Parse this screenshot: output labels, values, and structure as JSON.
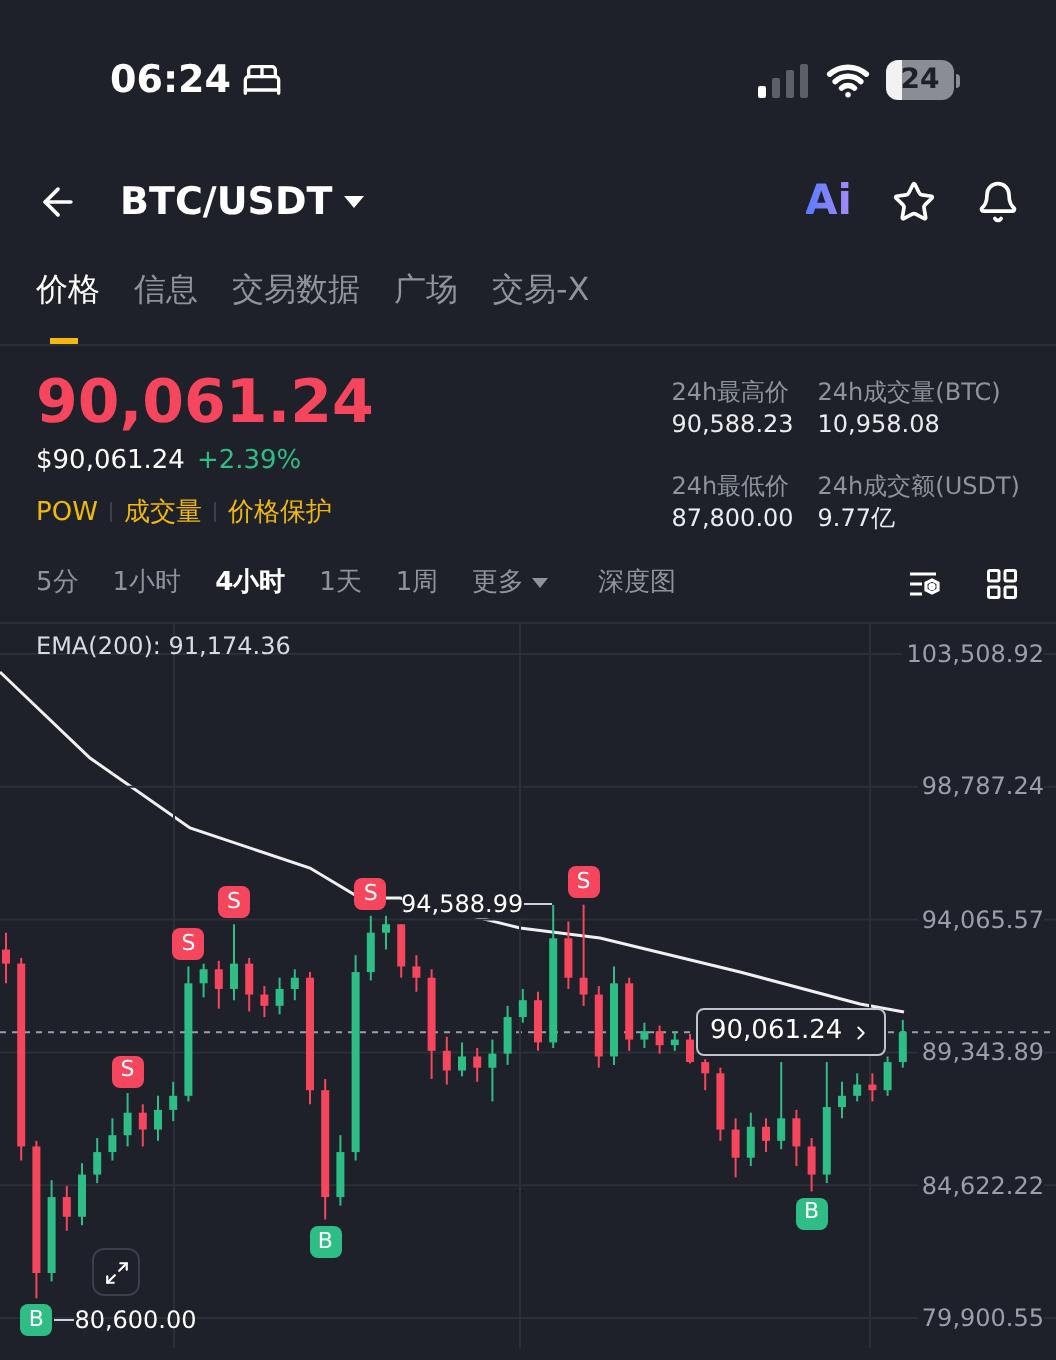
{
  "status_bar": {
    "time": "06:24",
    "battery": "24"
  },
  "header": {
    "pair": "BTC/USDT",
    "ai_label": "Ai"
  },
  "tabs": [
    {
      "label": "价格",
      "selected": true
    },
    {
      "label": "信息",
      "selected": false
    },
    {
      "label": "交易数据",
      "selected": false
    },
    {
      "label": "广场",
      "selected": false
    },
    {
      "label": "交易-X",
      "selected": false
    }
  ],
  "price": {
    "last": "90,061.24",
    "fiat": "$90,061.24",
    "change": "+2.39%",
    "tags": [
      "POW",
      "成交量",
      "价格保护"
    ]
  },
  "stats": [
    {
      "label": "24h最高价",
      "value": "90,588.23"
    },
    {
      "label": "24h成交量(BTC)",
      "value": "10,958.08"
    },
    {
      "label": "24h最低价",
      "value": "87,800.00"
    },
    {
      "label": "24h成交额(USDT)",
      "value": "9.77亿"
    }
  ],
  "intervals": [
    {
      "label": "5分",
      "selected": false,
      "kind": "plain"
    },
    {
      "label": "1小时",
      "selected": false,
      "kind": "plain"
    },
    {
      "label": "4小时",
      "selected": true,
      "kind": "plain"
    },
    {
      "label": "1天",
      "selected": false,
      "kind": "plain"
    },
    {
      "label": "1周",
      "selected": false,
      "kind": "plain"
    },
    {
      "label": "更多",
      "selected": false,
      "kind": "dropdown"
    },
    {
      "label": "深度图",
      "selected": false,
      "kind": "plain"
    }
  ],
  "chart": {
    "indicator": "EMA(200): 91,174.36",
    "price_tag": "90,061.24",
    "high_label": "94,588.99",
    "low_label": "80,600.00",
    "markers": [
      {
        "kind": "sell",
        "label": "S"
      },
      {
        "kind": "sell",
        "label": "S"
      },
      {
        "kind": "sell",
        "label": "S"
      },
      {
        "kind": "sell",
        "label": "S"
      },
      {
        "kind": "sell",
        "label": "S"
      },
      {
        "kind": "buy",
        "label": "B"
      },
      {
        "kind": "buy",
        "label": "B"
      },
      {
        "kind": "buy",
        "label": "B"
      }
    ],
    "chart_data": {
      "type": "candlestick",
      "ylim": [
        79900.55,
        103508.92
      ],
      "grid": true,
      "yticks": [
        {
          "value": 103508.92,
          "label": "103,508.92"
        },
        {
          "value": 98787.24,
          "label": "98,787.24"
        },
        {
          "value": 94065.57,
          "label": "94,065.57"
        },
        {
          "value": 89343.89,
          "label": "89,343.89"
        },
        {
          "value": 84622.22,
          "label": "84,622.22"
        },
        {
          "value": 79900.55,
          "label": "79,900.55"
        }
      ],
      "ohlc": [
        [
          93000,
          93600,
          91800,
          92500
        ],
        [
          92500,
          92700,
          85500,
          86000
        ],
        [
          86000,
          86200,
          80600,
          81500
        ],
        [
          81500,
          84800,
          81200,
          84200
        ],
        [
          84200,
          84600,
          83000,
          83500
        ],
        [
          83500,
          85400,
          83200,
          85000
        ],
        [
          85000,
          86300,
          84700,
          85800
        ],
        [
          85800,
          87000,
          85500,
          86400
        ],
        [
          86400,
          87900,
          86000,
          87200
        ],
        [
          87200,
          87500,
          86000,
          86600
        ],
        [
          86600,
          87800,
          86200,
          87300
        ],
        [
          87300,
          88300,
          86900,
          87800
        ],
        [
          87800,
          92400,
          87600,
          91800
        ],
        [
          91800,
          92500,
          91300,
          92300
        ],
        [
          92300,
          92600,
          90900,
          91600
        ],
        [
          91600,
          93900,
          91200,
          92500
        ],
        [
          92500,
          92700,
          90800,
          91400
        ],
        [
          91400,
          91700,
          90600,
          91000
        ],
        [
          91000,
          92000,
          90700,
          91600
        ],
        [
          91600,
          92300,
          91200,
          92000
        ],
        [
          92000,
          92200,
          87500,
          88000
        ],
        [
          88000,
          88400,
          83400,
          84200
        ],
        [
          84200,
          86400,
          83900,
          85800
        ],
        [
          85800,
          92800,
          85500,
          92200
        ],
        [
          92200,
          94200,
          91900,
          93600
        ],
        [
          93600,
          94200,
          93000,
          93900
        ],
        [
          93900,
          93900,
          92000,
          92400
        ],
        [
          92400,
          92800,
          91500,
          92000
        ],
        [
          92000,
          92300,
          88400,
          89400
        ],
        [
          89400,
          89900,
          88200,
          88700
        ],
        [
          88700,
          89700,
          88500,
          89200
        ],
        [
          89200,
          89500,
          88300,
          88800
        ],
        [
          88800,
          89800,
          87600,
          89300
        ],
        [
          89300,
          91000,
          88900,
          90600
        ],
        [
          90600,
          91600,
          90400,
          91200
        ],
        [
          91200,
          91500,
          89400,
          89700
        ],
        [
          89700,
          94589,
          89500,
          93400
        ],
        [
          93400,
          94000,
          91600,
          92000
        ],
        [
          92000,
          94600,
          91000,
          91400
        ],
        [
          91400,
          91700,
          88800,
          89200
        ],
        [
          89200,
          92400,
          88900,
          91800
        ],
        [
          91800,
          92000,
          89400,
          89800
        ],
        [
          89800,
          90400,
          89500,
          90100
        ],
        [
          90100,
          90300,
          89300,
          89600
        ],
        [
          89600,
          90100,
          89400,
          89800
        ],
        [
          89800,
          90000,
          88950,
          89000
        ],
        [
          89000,
          89100,
          88000,
          88600
        ],
        [
          88600,
          88800,
          86200,
          86600
        ],
        [
          86600,
          87000,
          84900,
          85600
        ],
        [
          85600,
          87200,
          85300,
          86700
        ],
        [
          86700,
          87000,
          85800,
          86200
        ],
        [
          86200,
          89000,
          85900,
          87000
        ],
        [
          87000,
          87300,
          85300,
          86000
        ],
        [
          86000,
          86300,
          84400,
          85000
        ],
        [
          85000,
          89000,
          84700,
          87400
        ],
        [
          87400,
          88300,
          87000,
          87800
        ],
        [
          87800,
          88600,
          87600,
          88200
        ],
        [
          88200,
          88600,
          87600,
          88000
        ],
        [
          88000,
          89200,
          87800,
          89000
        ],
        [
          89000,
          90500,
          88800,
          90061.24
        ]
      ]
    }
  }
}
